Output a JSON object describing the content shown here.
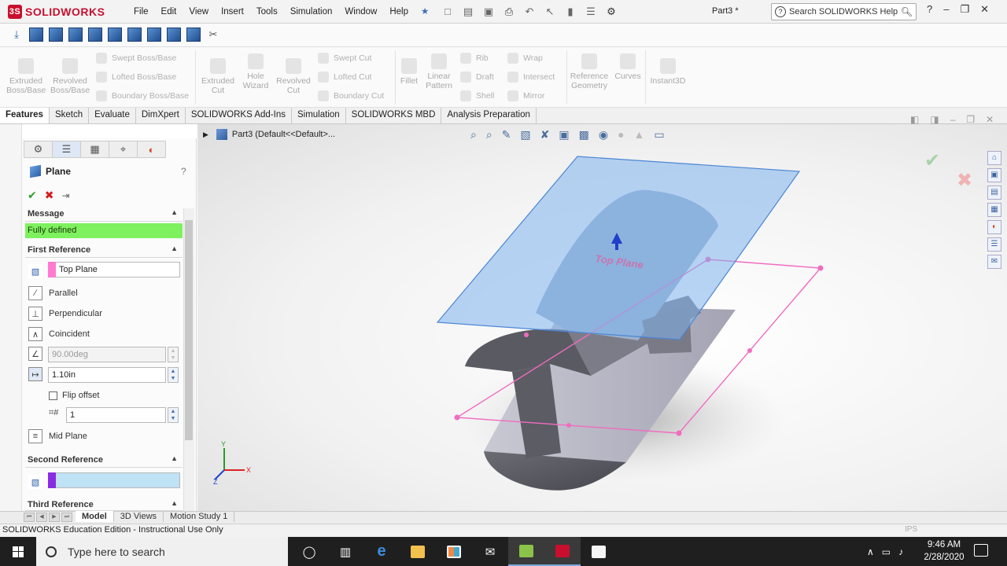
{
  "app": {
    "logo_text": "SOLIDWORKS",
    "menus": [
      "File",
      "Edit",
      "View",
      "Insert",
      "Tools",
      "Simulation",
      "Window",
      "Help"
    ],
    "document_title": "Part3 *",
    "search_placeholder": "Search SOLIDWORKS Help"
  },
  "command_manager": {
    "large": [
      {
        "label": "Extruded\nBoss/Base"
      },
      {
        "label": "Revolved\nBoss/Base"
      },
      {
        "label": "Extruded\nCut"
      },
      {
        "label": "Hole\nWizard"
      },
      {
        "label": "Revolved\nCut"
      },
      {
        "label": "Fillet"
      },
      {
        "label": "Linear\nPattern"
      },
      {
        "label": "Reference\nGeometry"
      },
      {
        "label": "Curves"
      },
      {
        "label": "Instant3D"
      }
    ],
    "small": {
      "swept_boss": "Swept Boss/Base",
      "lofted_boss": "Lofted Boss/Base",
      "boundary_boss": "Boundary Boss/Base",
      "swept_cut": "Swept Cut",
      "lofted_cut": "Lofted Cut",
      "boundary_cut": "Boundary Cut",
      "rib": "Rib",
      "draft": "Draft",
      "shell": "Shell",
      "wrap": "Wrap",
      "intersect": "Intersect",
      "mirror": "Mirror"
    }
  },
  "tabs": [
    "Features",
    "Sketch",
    "Evaluate",
    "DimXpert",
    "SOLIDWORKS Add-Ins",
    "Simulation",
    "SOLIDWORKS MBD",
    "Analysis Preparation"
  ],
  "breadcrumb": "Part3  (Default<<Default>...",
  "property_manager": {
    "title": "Plane",
    "message_header": "Message",
    "message": "Fully defined",
    "first_ref_header": "First Reference",
    "first_ref_value": "Top Plane",
    "options": {
      "parallel": "Parallel",
      "perpendicular": "Perpendicular",
      "coincident": "Coincident"
    },
    "angle_value": "90.00deg",
    "distance_value": "1.10in",
    "flip_offset": "Flip offset",
    "instances_value": "1",
    "mid_plane": "Mid Plane",
    "second_ref_header": "Second Reference",
    "third_ref_header": "Third Reference"
  },
  "viewport": {
    "plane_label": "Top Plane"
  },
  "bottom_tabs": [
    "Model",
    "3D Views",
    "Motion Study 1"
  ],
  "status_text": "SOLIDWORKS Education Edition - Instructional Use Only",
  "units": "IPS",
  "taskbar": {
    "search_placeholder": "Type here to search",
    "time": "9:46 AM",
    "date": "2/28/2020"
  }
}
